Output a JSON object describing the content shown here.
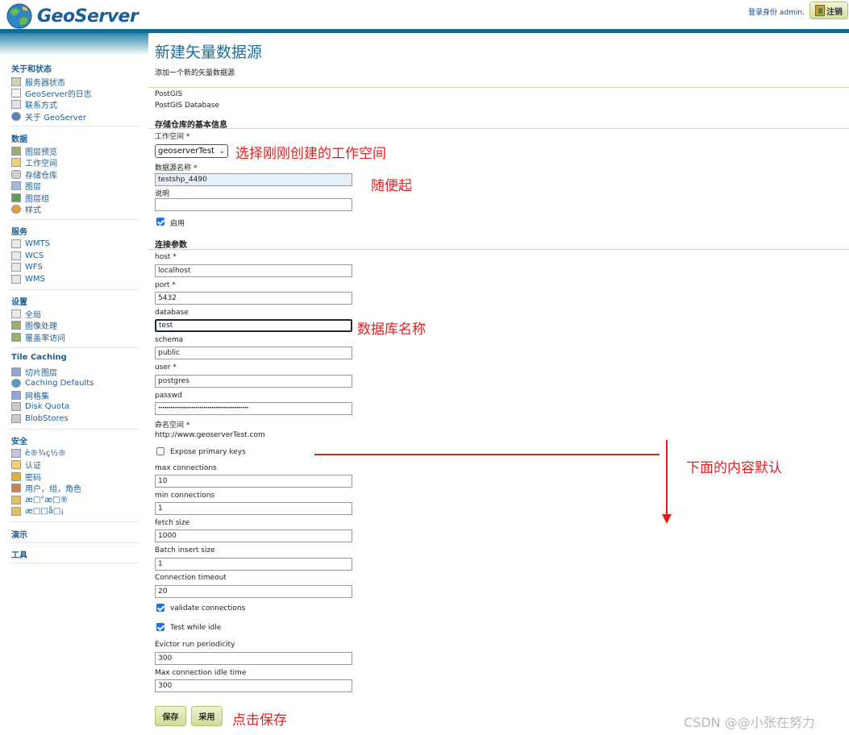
{
  "header": {
    "logo_text": "GeoServer",
    "login_status": "登录身份 admin.",
    "logout_label": "注销"
  },
  "sidebar": {
    "sections": [
      {
        "title": "关于和状态",
        "items": [
          "服务器状态",
          "GeoServer的日志",
          "联系方式",
          "关于 GeoServer"
        ]
      },
      {
        "title": "数据",
        "items": [
          "图层预览",
          "工作空间",
          "存储仓库",
          "图层",
          "图层组",
          "样式"
        ]
      },
      {
        "title": "服务",
        "items": [
          "WMTS",
          "WCS",
          "WFS",
          "WMS"
        ]
      },
      {
        "title": "设置",
        "items": [
          "全局",
          "图像处理",
          "覆盖率访问"
        ]
      },
      {
        "title": "Tile Caching",
        "items": [
          "切片图层",
          "Caching Defaults",
          "网格集",
          "Disk Quota",
          "BlobStores"
        ]
      },
      {
        "title": "安全",
        "items": [
          "è®¾ç½®",
          "认证",
          "密码",
          "用户，组，角色",
          "æ□°æ□®",
          "æ□□å□¡"
        ]
      },
      {
        "title": "演示",
        "items": []
      },
      {
        "title": "工具",
        "items": []
      }
    ]
  },
  "main": {
    "title": "新建矢量数据源",
    "subtitle": "添加一个新的矢量数据源",
    "store_type": "PostGIS",
    "store_desc": "PostGIS Database",
    "basic_section": "存储仓库的基本信息",
    "workspace_label": "工作空间 *",
    "workspace_value": "geoserverTest",
    "datasource_label": "数据源名称 *",
    "datasource_value": "testshp_4490",
    "description_label": "说明",
    "description_value": "",
    "enabled_label": "启用",
    "conn_section": "连接参数",
    "host_label": "host *",
    "host_value": "localhost",
    "port_label": "port *",
    "port_value": "5432",
    "database_label": "database",
    "database_value": "test",
    "schema_label": "schema",
    "schema_value": "public",
    "user_label": "user *",
    "user_value": "postgres",
    "passwd_label": "passwd",
    "passwd_value": "••••••••••••••••••••••••••••••••••••••••••••",
    "namespace_label": "命名空间 *",
    "namespace_value": "http://www.geoserverTest.com",
    "expose_pk_label": "Expose primary keys",
    "max_conn_label": "max connections",
    "max_conn_value": "10",
    "min_conn_label": "min connections",
    "min_conn_value": "1",
    "fetch_size_label": "fetch size",
    "fetch_size_value": "1000",
    "batch_label": "Batch insert size",
    "batch_value": "1",
    "timeout_label": "Connection timeout",
    "timeout_value": "20",
    "validate_label": "validate connections",
    "idle_test_label": "Test while idle",
    "evictor_label": "Evictor run periodicity",
    "evictor_value": "300",
    "max_idle_label": "Max connection idle time",
    "max_idle_value": "300"
  },
  "buttons": {
    "save": "保存",
    "apply": "采用"
  },
  "annotations": {
    "workspace_note": "选择刚刚创建的工作空间",
    "name_note": "随便起",
    "database_note": "数据库名称",
    "default_note": "下面的内容默认",
    "save_note": "点击保存"
  },
  "watermark": "CSDN @@小张在努力",
  "colors": {
    "accent_blue": "#0e6b92",
    "link_blue": "#1a5e97",
    "annotation_red": "#e02020"
  }
}
